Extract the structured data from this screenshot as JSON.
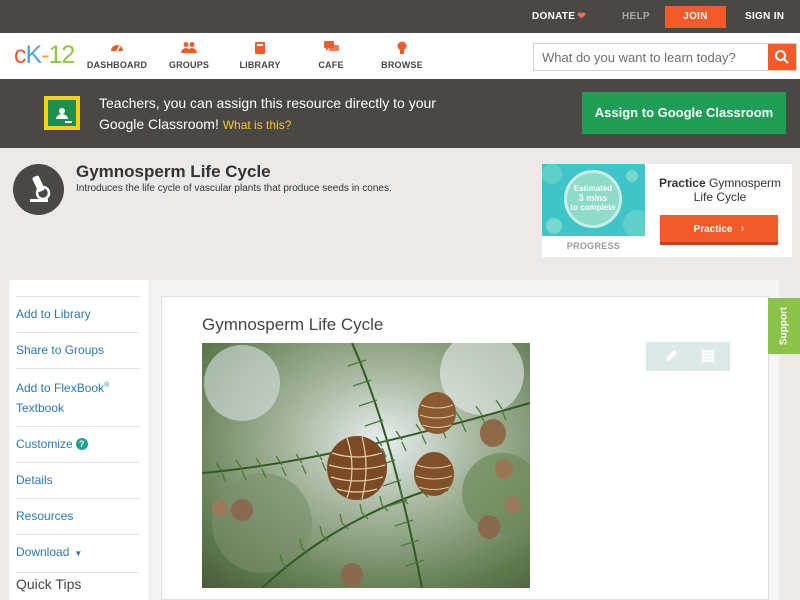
{
  "topbar": {
    "donate": "DONATE",
    "help": "HELP",
    "join": "JOIN",
    "sign_in": "SIGN IN"
  },
  "nav": {
    "logo": {
      "c": "c",
      "k": "K",
      "dash": "-",
      "num": "12"
    },
    "items": [
      {
        "label": "DASHBOARD",
        "icon": "dashboard-icon"
      },
      {
        "label": "GROUPS",
        "icon": "groups-icon"
      },
      {
        "label": "LIBRARY",
        "icon": "library-icon"
      },
      {
        "label": "CAFE",
        "icon": "cafe-icon"
      },
      {
        "label": "BROWSE",
        "icon": "lightbulb-icon"
      }
    ],
    "search_placeholder": "What do you want to learn today?"
  },
  "banner": {
    "text": "Teachers, you can assign this resource directly to your Google Classroom!",
    "link": "What is this?",
    "button": "Assign to Google Classroom"
  },
  "lesson": {
    "title": "Gymnosperm Life Cycle",
    "description": "Introduces the life cycle of vascular plants that produce seeds in cones."
  },
  "practice": {
    "estimated": "Estimated",
    "mins": "3 mins",
    "to_complete": "to complete",
    "progress": "PROGRESS",
    "title_strong": "Practice",
    "title_rest": "Gymnosperm Life Cycle",
    "button": "Practice"
  },
  "sidebar": {
    "items": [
      {
        "label": "Add to Library"
      },
      {
        "label": "Share to Groups"
      },
      {
        "label": "Add to FlexBook",
        "sup": "®",
        "label2": "Textbook"
      },
      {
        "label": "Customize",
        "badge": "?"
      },
      {
        "label": "Details"
      },
      {
        "label": "Resources"
      },
      {
        "label": "Download",
        "caret": "▼"
      }
    ],
    "quick_tips": "Quick Tips"
  },
  "content": {
    "title": "Gymnosperm Life Cycle"
  },
  "support": "Support",
  "colors": {
    "brand_orange": "#f15a29",
    "dark_bar": "#4a4845",
    "google_green": "#1f9d55",
    "link_blue": "#2a7ab0",
    "support_green": "#8bc34a"
  }
}
